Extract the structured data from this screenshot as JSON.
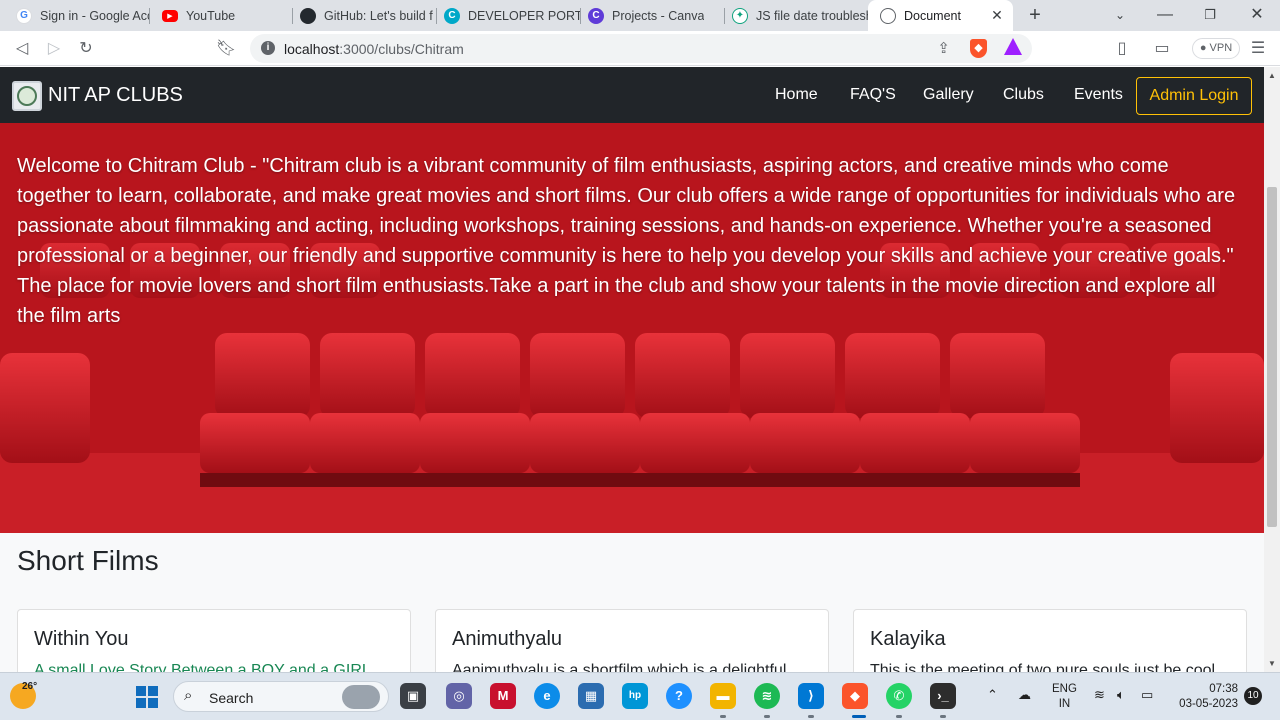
{
  "browser": {
    "tabs": [
      {
        "title": "Sign in - Google Acc",
        "icon": "google-icon",
        "color": "#4285f4",
        "glyph": "G"
      },
      {
        "title": "YouTube",
        "icon": "youtube-icon",
        "color": "#ff0000",
        "glyph": "▶"
      },
      {
        "title": "GitHub: Let's build f",
        "icon": "github-icon",
        "color": "#24292f",
        "glyph": "●"
      },
      {
        "title": "DEVELOPER PORTFC",
        "icon": "canva-icon",
        "color": "#00c4cc",
        "glyph": "C"
      },
      {
        "title": "Projects - Canva",
        "icon": "canva-icon",
        "color": "#7d2ae8",
        "glyph": "C"
      },
      {
        "title": "JS file date troublesh",
        "icon": "chatgpt-icon",
        "color": "#10a37f",
        "glyph": "✦"
      },
      {
        "title": "Document",
        "icon": "globe-icon",
        "color": "#5f6368",
        "glyph": "◍",
        "active": true
      }
    ],
    "url_host": "localhost",
    "url_rest": ":3000/clubs/Chitram",
    "vpn_label": "VPN"
  },
  "site": {
    "brand": "NIT AP CLUBS",
    "nav": [
      {
        "label": "Home"
      },
      {
        "label": "FAQ'S"
      },
      {
        "label": "Gallery"
      },
      {
        "label": "Clubs"
      },
      {
        "label": "Events"
      }
    ],
    "admin_login": "Admin Login",
    "hero_text": "Welcome to Chitram Club - \"Chitram club is a vibrant community of film enthusiasts, aspiring actors, and creative minds who come together to learn, collaborate, and make great movies and short films. Our club offers a wide range of opportunities for individuals who are passionate about filmmaking and acting, including workshops, training sessions, and hands-on experience. Whether you're a seasoned professional or a beginner, our friendly and supportive community is here to help you develop your skills and achieve your creative goals.\" The place for movie lovers and short film enthusiasts.Take a part in the club and show your talents in the movie direction and explore all the film arts",
    "section_title": "Short Films",
    "films": [
      {
        "title": "Within You",
        "text": "A small Love Story Between a BOY and a GIRL"
      },
      {
        "title": "Animuthyalu",
        "text": "Aanimuthyalu is a shortfilm which is a delightful"
      },
      {
        "title": "Kalayika",
        "text": "This is the meeting of two pure souls just be cool"
      }
    ]
  },
  "taskbar": {
    "temperature": "26°",
    "search_label": "Search",
    "lang_line1": "ENG",
    "lang_line2": "IN",
    "time": "07:38",
    "date": "03-05-2023",
    "notifications": "10"
  }
}
